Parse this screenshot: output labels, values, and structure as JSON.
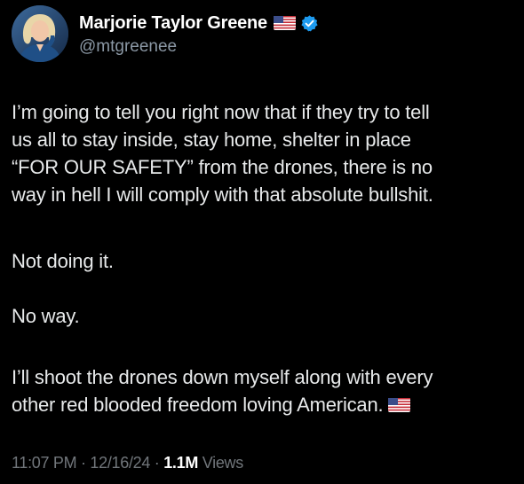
{
  "author": {
    "display_name": "Marjorie Taylor Greene",
    "handle": "@mtgreenee",
    "name_badge_icon": "us-flag-icon",
    "verified_icon": "verified-badge-icon"
  },
  "tweet": {
    "paragraphs": [
      [
        "I’m going to tell you right now that if they try to tell",
        "us all to stay inside, stay home, shelter in place",
        "“FOR OUR SAFETY” from the drones, there is no",
        "way in hell I will comply with that absolute bullshit."
      ],
      [
        "Not doing it."
      ],
      [
        "No way."
      ],
      [
        "I’ll shoot the drones down myself along with every",
        "other red blooded freedom loving American."
      ]
    ],
    "trailing_icon": "us-flag-icon"
  },
  "meta": {
    "time": "11:07 PM",
    "separator": "·",
    "date": "12/16/24",
    "views_count": "1.1M",
    "views_label": "Views"
  },
  "colors": {
    "background": "#000000",
    "text": "#e7e9ea",
    "secondary": "#71767b",
    "verified": "#1d9bf0"
  }
}
